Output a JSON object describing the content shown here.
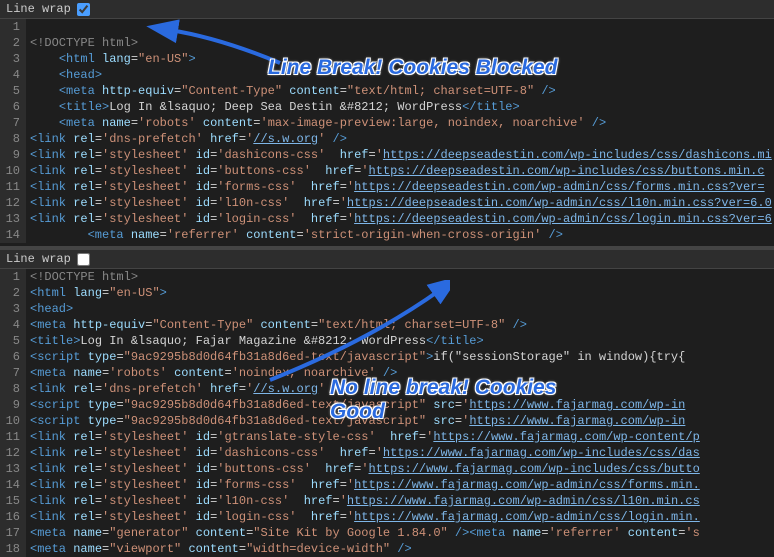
{
  "top": {
    "header": {
      "label": "Line wrap",
      "checked": true
    },
    "lines": [
      "",
      "<!DOCTYPE html>",
      "    <html lang=\"en-US\">",
      "    <head>",
      "    <meta http-equiv=\"Content-Type\" content=\"text/html; charset=UTF-8\" />",
      "    <title>Log In &lsaquo; Deep Sea Destin &#8212; WordPress</title>",
      "    <meta name='robots' content='max-image-preview:large, noindex, noarchive' />",
      "<link rel='dns-prefetch' href='//s.w.org' />",
      "<link rel='stylesheet' id='dashicons-css'  href='https://deepseadestin.com/wp-includes/css/dashicons.mi",
      "<link rel='stylesheet' id='buttons-css'  href='https://deepseadestin.com/wp-includes/css/buttons.min.c",
      "<link rel='stylesheet' id='forms-css'  href='https://deepseadestin.com/wp-admin/css/forms.min.css?ver=",
      "<link rel='stylesheet' id='l10n-css'  href='https://deepseadestin.com/wp-admin/css/l10n.min.css?ver=6.0",
      "<link rel='stylesheet' id='login-css'  href='https://deepseadestin.com/wp-admin/css/login.min.css?ver=6",
      "        <meta name='referrer' content='strict-origin-when-cross-origin' />"
    ]
  },
  "bottom": {
    "header": {
      "label": "Line wrap",
      "checked": false
    },
    "lines": [
      "<!DOCTYPE html>",
      "<html lang=\"en-US\">",
      "<head>",
      "<meta http-equiv=\"Content-Type\" content=\"text/html; charset=UTF-8\" />",
      "<title>Log In &lsaquo; Fajar Magazine &#8212; WordPress</title>",
      "<script type=\"9ac9295b8d0d64fb31a8d6ed-text/javascript\">if(\"sessionStorage\" in window){try{",
      "<meta name='robots' content='noindex, noarchive' />",
      "<link rel='dns-prefetch' href='//s.w.org' />",
      "<script type=\"9ac9295b8d0d64fb31a8d6ed-text/javascript\" src='https://www.fajarmag.com/wp-in",
      "<script type=\"9ac9295b8d0d64fb31a8d6ed-text/javascript\" src='https://www.fajarmag.com/wp-in",
      "<link rel='stylesheet' id='gtranslate-style-css'  href='https://www.fajarmag.com/wp-content/p",
      "<link rel='stylesheet' id='dashicons-css'  href='https://www.fajarmag.com/wp-includes/css/das",
      "<link rel='stylesheet' id='buttons-css'  href='https://www.fajarmag.com/wp-includes/css/butto",
      "<link rel='stylesheet' id='forms-css'  href='https://www.fajarmag.com/wp-admin/css/forms.min.",
      "<link rel='stylesheet' id='l10n-css'  href='https://www.fajarmag.com/wp-admin/css/l10n.min.cs",
      "<link rel='stylesheet' id='login-css'  href='https://www.fajarmag.com/wp-admin/css/login.min.",
      "<meta name=\"generator\" content=\"Site Kit by Google 1.84.0\" /><meta name='referrer' content='s",
      "<meta name=\"viewport\" content=\"width=device-width\" />"
    ]
  },
  "annotations": {
    "top": "Line Break! Cookies Blocked",
    "bottom_line1": "No line break! Cookies",
    "bottom_line2": "Good"
  },
  "colors": {
    "annotation": "#2a6adf",
    "bg": "#1e1e1e",
    "tag": "#569cd6",
    "attr": "#9cdcfe",
    "string": "#ce9178",
    "url": "#7eb6e8"
  }
}
